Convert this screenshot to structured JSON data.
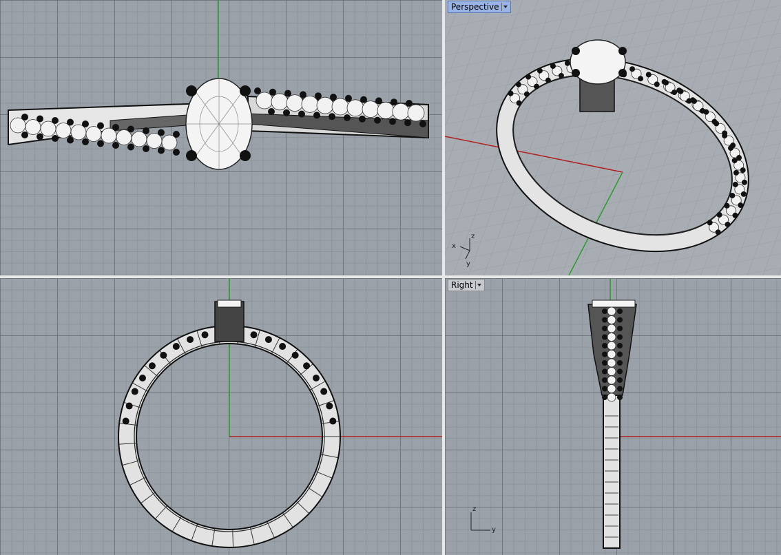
{
  "viewports": {
    "top": {
      "label": ""
    },
    "perspective": {
      "label": "Perspective"
    },
    "front": {
      "label": ""
    },
    "right": {
      "label": "Right"
    }
  },
  "axis_labels": {
    "perspective": {
      "x": "x",
      "y": "y",
      "z": "z"
    },
    "right": {
      "y": "y",
      "z": "z"
    }
  },
  "colors": {
    "viewport_bg": "#9aa1a9",
    "x_axis": "#b02020",
    "y_axis": "#2a9a2a",
    "active_label": "#9bb4e6",
    "wire": "#111111",
    "gem": "#f4f4f4"
  }
}
